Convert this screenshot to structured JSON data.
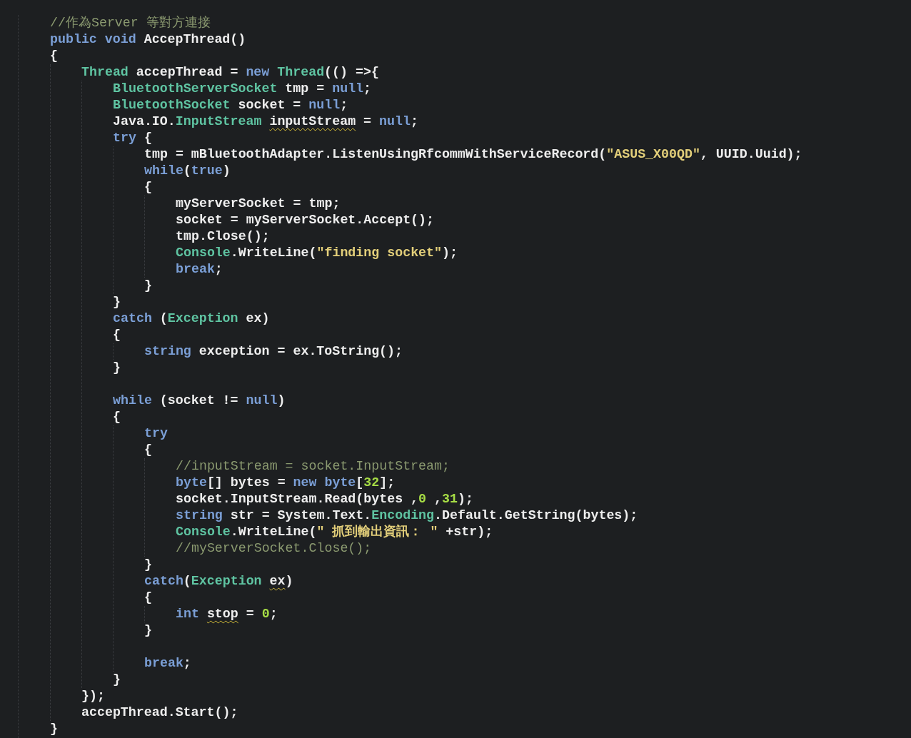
{
  "editor": {
    "lines": [
      {
        "kind": "code",
        "tokens": [
          {
            "kind": "comment",
            "text": "//作為Server 等對方連接"
          }
        ]
      },
      {
        "kind": "code",
        "tokens": [
          {
            "kind": "keyword",
            "text": "public void"
          },
          {
            "kind": "plain",
            "text": " AccepThread()"
          }
        ]
      },
      {
        "kind": "code",
        "tokens": [
          {
            "kind": "plain",
            "text": "{"
          }
        ],
        "children": [
          {
            "kind": "code",
            "tokens": [
              {
                "kind": "type",
                "text": "Thread"
              },
              {
                "kind": "plain",
                "text": " accepThread = "
              },
              {
                "kind": "keyword",
                "text": "new "
              },
              {
                "kind": "type",
                "text": "Thread"
              },
              {
                "kind": "plain",
                "text": "(() =>{"
              }
            ],
            "children": [
              {
                "kind": "code",
                "tokens": [
                  {
                    "kind": "type",
                    "text": "BluetoothServerSocket"
                  },
                  {
                    "kind": "plain",
                    "text": " tmp = "
                  },
                  {
                    "kind": "keyword",
                    "text": "null"
                  },
                  {
                    "kind": "plain",
                    "text": ";"
                  }
                ]
              },
              {
                "kind": "code",
                "tokens": [
                  {
                    "kind": "type",
                    "text": "BluetoothSocket"
                  },
                  {
                    "kind": "plain",
                    "text": " socket = "
                  },
                  {
                    "kind": "keyword",
                    "text": "null"
                  },
                  {
                    "kind": "plain",
                    "text": ";"
                  }
                ]
              },
              {
                "kind": "code",
                "tokens": [
                  {
                    "kind": "plain",
                    "text": "Java.IO."
                  },
                  {
                    "kind": "type",
                    "text": "InputStream "
                  },
                  {
                    "kind": "flagged",
                    "text": "inputStream"
                  },
                  {
                    "kind": "plain",
                    "text": " = "
                  },
                  {
                    "kind": "keyword",
                    "text": "null"
                  },
                  {
                    "kind": "plain",
                    "text": ";"
                  }
                ]
              },
              {
                "kind": "code",
                "tokens": [
                  {
                    "kind": "keyword",
                    "text": "try"
                  },
                  {
                    "kind": "plain",
                    "text": " {"
                  }
                ],
                "children": [
                  {
                    "kind": "code",
                    "tokens": [
                      {
                        "kind": "plain",
                        "text": "tmp = mBluetoothAdapter.ListenUsingRfcommWithServiceRecord("
                      },
                      {
                        "kind": "string",
                        "text": "\"ASUS_X00QD\""
                      },
                      {
                        "kind": "plain",
                        "text": ", UUID.Uuid);"
                      }
                    ]
                  },
                  {
                    "kind": "code",
                    "tokens": [
                      {
                        "kind": "keyword",
                        "text": "while"
                      },
                      {
                        "kind": "plain",
                        "text": "("
                      },
                      {
                        "kind": "keyword",
                        "text": "true"
                      },
                      {
                        "kind": "plain",
                        "text": ")"
                      }
                    ]
                  },
                  {
                    "kind": "code",
                    "tokens": [
                      {
                        "kind": "plain",
                        "text": "{"
                      }
                    ],
                    "children": [
                      {
                        "kind": "code",
                        "tokens": [
                          {
                            "kind": "plain",
                            "text": "myServerSocket = tmp;"
                          }
                        ]
                      },
                      {
                        "kind": "code",
                        "tokens": [
                          {
                            "kind": "plain",
                            "text": "socket = myServerSocket.Accept();"
                          }
                        ]
                      },
                      {
                        "kind": "code",
                        "tokens": [
                          {
                            "kind": "plain",
                            "text": "tmp.Close();"
                          }
                        ]
                      },
                      {
                        "kind": "code",
                        "tokens": [
                          {
                            "kind": "type",
                            "text": "Console"
                          },
                          {
                            "kind": "plain",
                            "text": ".WriteLine("
                          },
                          {
                            "kind": "string",
                            "text": "\"finding socket\""
                          },
                          {
                            "kind": "plain",
                            "text": ");"
                          }
                        ]
                      },
                      {
                        "kind": "code",
                        "tokens": [
                          {
                            "kind": "keyword",
                            "text": "break"
                          },
                          {
                            "kind": "plain",
                            "text": ";"
                          }
                        ]
                      }
                    ]
                  },
                  {
                    "kind": "code",
                    "tokens": [
                      {
                        "kind": "plain",
                        "text": "}"
                      }
                    ]
                  }
                ]
              },
              {
                "kind": "code",
                "tokens": [
                  {
                    "kind": "plain",
                    "text": "}"
                  }
                ]
              },
              {
                "kind": "code",
                "tokens": [
                  {
                    "kind": "keyword",
                    "text": "catch"
                  },
                  {
                    "kind": "plain",
                    "text": " ("
                  },
                  {
                    "kind": "type",
                    "text": "Exception"
                  },
                  {
                    "kind": "plain",
                    "text": " ex)"
                  }
                ]
              },
              {
                "kind": "code",
                "tokens": [
                  {
                    "kind": "plain",
                    "text": "{"
                  }
                ],
                "children": [
                  {
                    "kind": "code",
                    "tokens": [
                      {
                        "kind": "keyword",
                        "text": "string"
                      },
                      {
                        "kind": "plain",
                        "text": " exception = ex.ToString();"
                      }
                    ]
                  }
                ]
              },
              {
                "kind": "code",
                "tokens": [
                  {
                    "kind": "plain",
                    "text": "}"
                  }
                ]
              },
              {
                "kind": "blank"
              },
              {
                "kind": "code",
                "tokens": [
                  {
                    "kind": "keyword",
                    "text": "while"
                  },
                  {
                    "kind": "plain",
                    "text": " (socket != "
                  },
                  {
                    "kind": "keyword",
                    "text": "null"
                  },
                  {
                    "kind": "plain",
                    "text": ")"
                  }
                ]
              },
              {
                "kind": "code",
                "tokens": [
                  {
                    "kind": "plain",
                    "text": "{"
                  }
                ],
                "children": [
                  {
                    "kind": "code",
                    "tokens": [
                      {
                        "kind": "keyword",
                        "text": "try"
                      }
                    ]
                  },
                  {
                    "kind": "code",
                    "tokens": [
                      {
                        "kind": "plain",
                        "text": "{"
                      }
                    ],
                    "children": [
                      {
                        "kind": "code",
                        "tokens": [
                          {
                            "kind": "comment",
                            "text": "//inputStream = socket.InputStream;"
                          }
                        ]
                      },
                      {
                        "kind": "code",
                        "tokens": [
                          {
                            "kind": "keyword",
                            "text": "byte"
                          },
                          {
                            "kind": "plain",
                            "text": "[] bytes = "
                          },
                          {
                            "kind": "keyword",
                            "text": "new byte"
                          },
                          {
                            "kind": "plain",
                            "text": "["
                          },
                          {
                            "kind": "number",
                            "text": "32"
                          },
                          {
                            "kind": "plain",
                            "text": "];"
                          }
                        ]
                      },
                      {
                        "kind": "code",
                        "tokens": [
                          {
                            "kind": "plain",
                            "text": "socket.InputStream.Read(bytes ,"
                          },
                          {
                            "kind": "number",
                            "text": "0"
                          },
                          {
                            "kind": "plain",
                            "text": " ,"
                          },
                          {
                            "kind": "number",
                            "text": "31"
                          },
                          {
                            "kind": "plain",
                            "text": ");"
                          }
                        ]
                      },
                      {
                        "kind": "code",
                        "tokens": [
                          {
                            "kind": "keyword",
                            "text": "string"
                          },
                          {
                            "kind": "plain",
                            "text": " str = System.Text."
                          },
                          {
                            "kind": "type",
                            "text": "Encoding"
                          },
                          {
                            "kind": "plain",
                            "text": ".Default.GetString(bytes);"
                          }
                        ]
                      },
                      {
                        "kind": "code",
                        "tokens": [
                          {
                            "kind": "type",
                            "text": "Console"
                          },
                          {
                            "kind": "plain",
                            "text": ".WriteLine("
                          },
                          {
                            "kind": "string",
                            "text": "\" 抓到輸出資訊： \""
                          },
                          {
                            "kind": "plain",
                            "text": " +str);"
                          }
                        ]
                      },
                      {
                        "kind": "code",
                        "tokens": [
                          {
                            "kind": "comment",
                            "text": "//myServerSocket.Close();"
                          }
                        ]
                      }
                    ]
                  },
                  {
                    "kind": "code",
                    "tokens": [
                      {
                        "kind": "plain",
                        "text": "}"
                      }
                    ]
                  },
                  {
                    "kind": "code",
                    "tokens": [
                      {
                        "kind": "keyword",
                        "text": "catch"
                      },
                      {
                        "kind": "plain",
                        "text": "("
                      },
                      {
                        "kind": "type",
                        "text": "Exception "
                      },
                      {
                        "kind": "flagged",
                        "text": "ex"
                      },
                      {
                        "kind": "plain",
                        "text": ")"
                      }
                    ]
                  },
                  {
                    "kind": "code",
                    "tokens": [
                      {
                        "kind": "plain",
                        "text": "{"
                      }
                    ],
                    "children": [
                      {
                        "kind": "code",
                        "tokens": [
                          {
                            "kind": "keyword",
                            "text": "int "
                          },
                          {
                            "kind": "flagged",
                            "text": "stop"
                          },
                          {
                            "kind": "plain",
                            "text": " = "
                          },
                          {
                            "kind": "number",
                            "text": "0"
                          },
                          {
                            "kind": "plain",
                            "text": ";"
                          }
                        ]
                      }
                    ]
                  },
                  {
                    "kind": "code",
                    "tokens": [
                      {
                        "kind": "plain",
                        "text": "}"
                      }
                    ]
                  },
                  {
                    "kind": "blank"
                  },
                  {
                    "kind": "code",
                    "tokens": [
                      {
                        "kind": "keyword",
                        "text": "break"
                      },
                      {
                        "kind": "plain",
                        "text": ";"
                      }
                    ]
                  }
                ]
              },
              {
                "kind": "code",
                "tokens": [
                  {
                    "kind": "plain",
                    "text": "}"
                  }
                ]
              }
            ]
          },
          {
            "kind": "code",
            "tokens": [
              {
                "kind": "plain",
                "text": "});"
              }
            ]
          },
          {
            "kind": "code",
            "tokens": [
              {
                "kind": "plain",
                "text": "accepThread.Start();"
              }
            ]
          }
        ]
      },
      {
        "kind": "code",
        "tokens": [
          {
            "kind": "plain",
            "text": "}"
          }
        ]
      }
    ]
  }
}
